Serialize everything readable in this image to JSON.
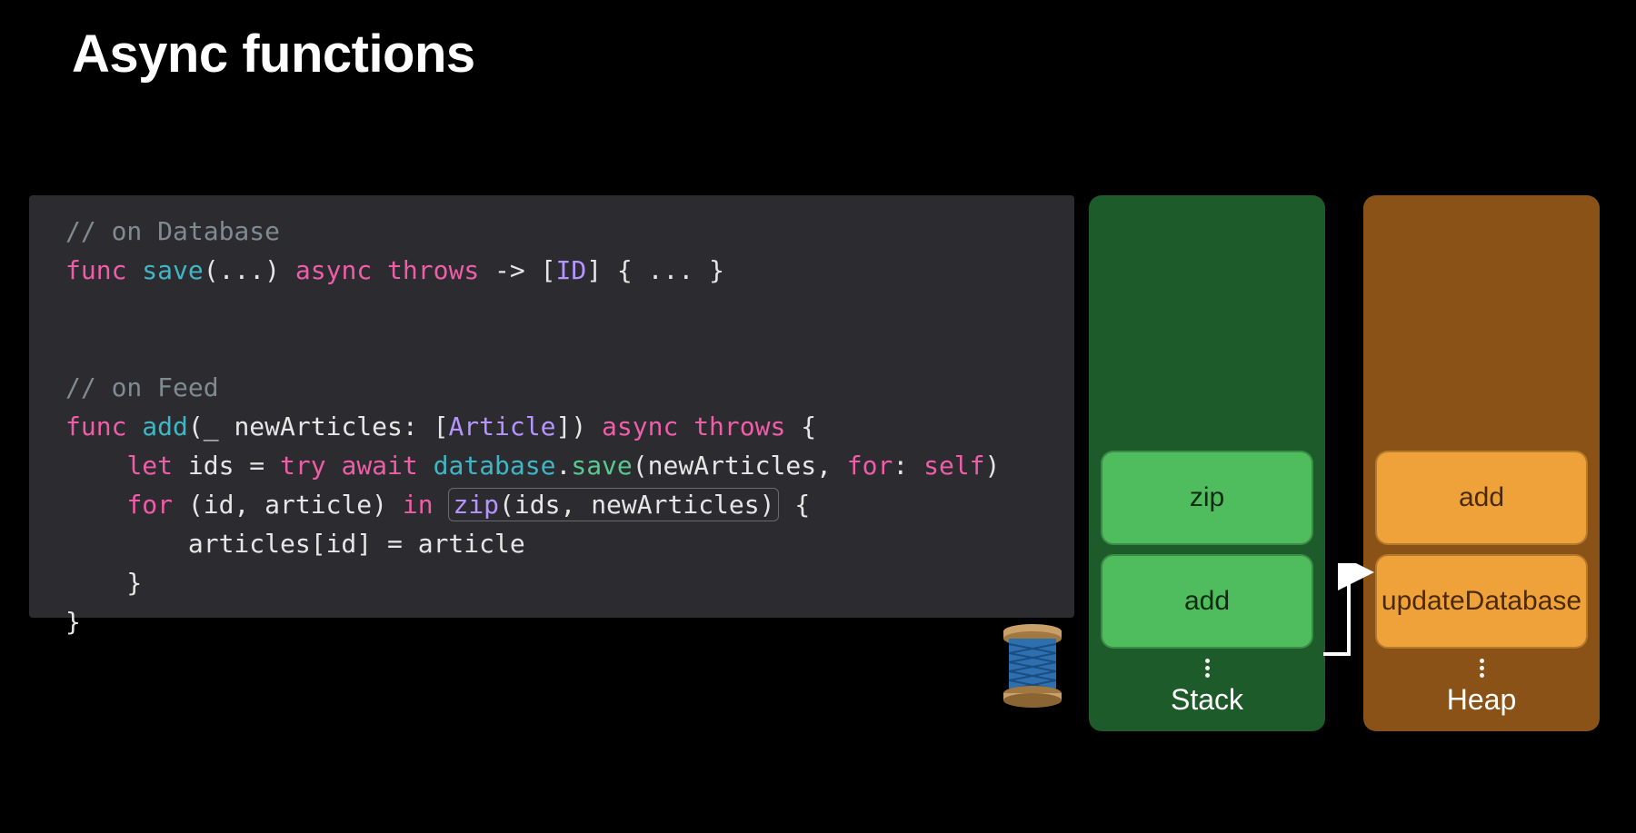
{
  "title": "Async functions",
  "code": {
    "comment1": "// on Database",
    "line2": {
      "func": "func",
      "save": "save",
      "openParenEllipsis": "(...)",
      "async": "async",
      "throws": "throws",
      "arrow": " -> [",
      "idType": "ID",
      "close": "] { ... }"
    },
    "comment2": "// on Feed",
    "line4": {
      "func": "func",
      "add": "add",
      "sig_pre": "(_ newArticles: [",
      "articleType": "Article",
      "sig_post": "]) ",
      "async": "async",
      "throws": "throws",
      "brace": " {"
    },
    "line5": {
      "indent": "    ",
      "let": "let",
      "ids": " ids = ",
      "try": "try",
      "await": "await",
      "database": " database",
      "dot": ".",
      "save": "save",
      "args": "(newArticles, ",
      "forLabel": "for",
      "colon": ": ",
      "self": "self",
      "end": ")"
    },
    "line6": {
      "indent": "    ",
      "for": "for",
      "tuple": " (id, article) ",
      "in": "in",
      "space": " ",
      "zip": "zip",
      "zipArgs": "(ids, newArticles)",
      "brace": " {"
    },
    "line7": {
      "indent": "        ",
      "body": "articles[id] = article"
    },
    "line8": "    }",
    "line9": "}"
  },
  "stack": {
    "label": "Stack",
    "frames": [
      "zip",
      "add"
    ]
  },
  "heap": {
    "label": "Heap",
    "frames": [
      "add",
      "updateDatabase"
    ]
  }
}
